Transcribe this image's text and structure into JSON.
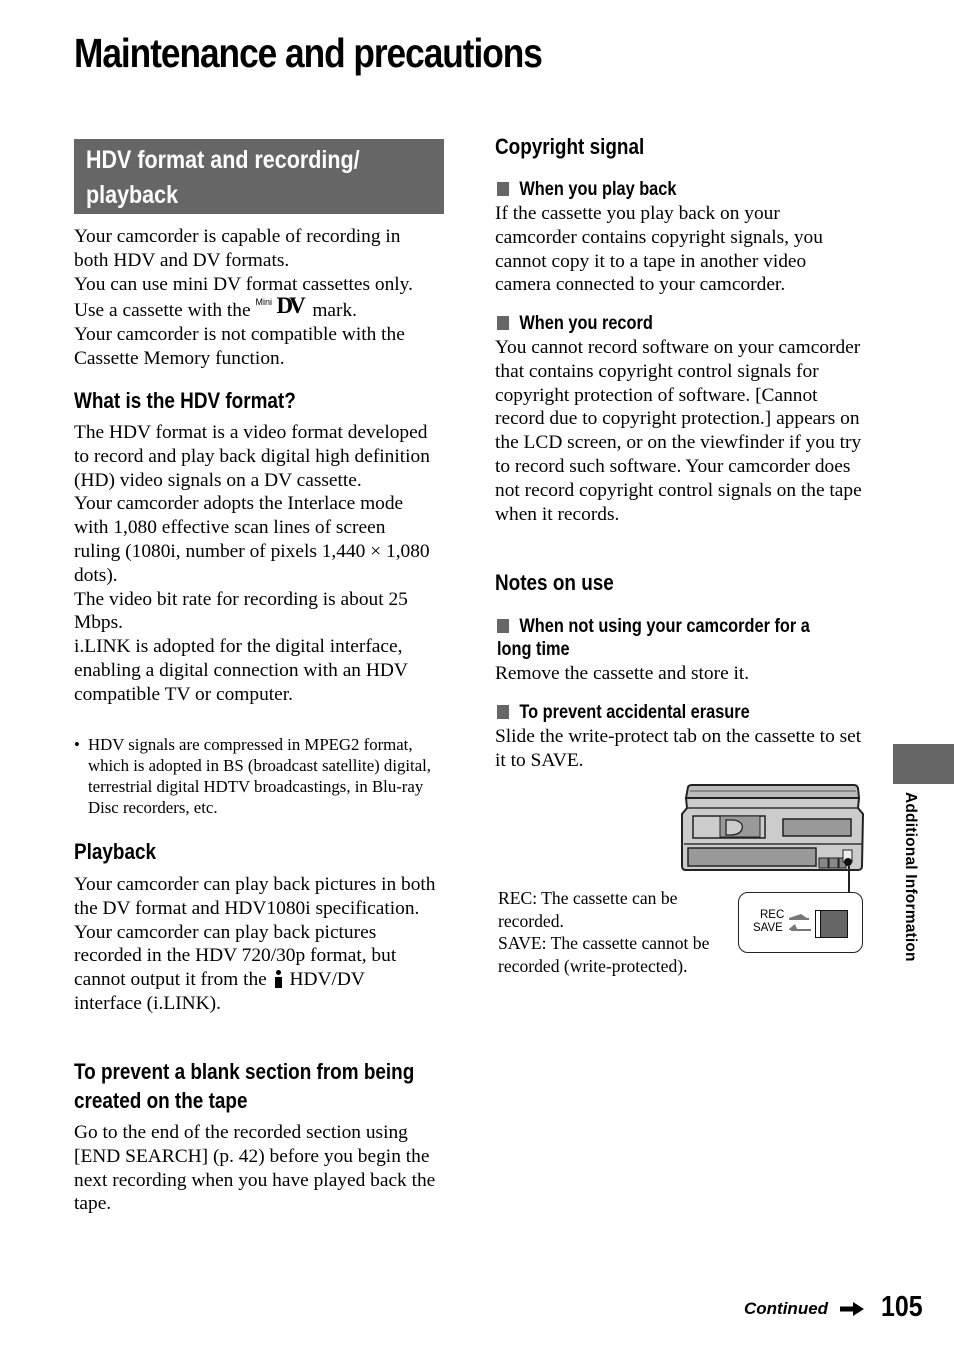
{
  "page": {
    "title": "Maintenance and precautions",
    "side_tab_label": "Additional Information",
    "footer": {
      "continued": "Continued",
      "page_number": "105"
    }
  },
  "left": {
    "banner": {
      "line1": "HDV format and recording/",
      "line2": "playback"
    },
    "intro": {
      "p1": "Your camcorder is capable of recording in both HDV and DV formats.",
      "p2": "You can use mini DV format cassettes only.",
      "p3_before": "Use a cassette with the",
      "p3_mark_small": "Mini",
      "p3_mark_big": "DV",
      "p3_after": "mark.",
      "p4": "Your camcorder is not compatible with the Cassette Memory function."
    },
    "hdv_format": {
      "heading": "What is the HDV format?",
      "p1": "The HDV format is a video format developed to record and play back digital high definition (HD) video signals on a DV cassette.",
      "p2": "Your camcorder adopts the Interlace mode with 1,080 effective scan lines of screen ruling (1080i, number of pixels 1,440 × 1,080 dots).",
      "p3": "The video bit rate for recording is about 25 Mbps.",
      "p4": "i.LINK is adopted for the digital interface, enabling a digital connection with an HDV compatible TV or computer.",
      "note_bullet": "•",
      "note": "HDV signals are compressed in MPEG2 format, which is adopted in BS (broadcast satellite) digital, terrestrial digital HDTV broadcastings, in Blu-ray Disc recorders, etc."
    },
    "playback": {
      "heading": "Playback",
      "p1": "Your camcorder can play back pictures in both the DV format and HDV1080i specification.",
      "p2_before": "Your camcorder can play back pictures recorded in the HDV 720/30p format, but cannot output it from the",
      "p2_icon": "i-link-icon",
      "p2_after": "HDV/DV interface (i.LINK)."
    },
    "blank_section": {
      "heading_line1": "To prevent a blank section from being",
      "heading_line2": "created on the tape",
      "p1": "Go to the end of the recorded section using [END SEARCH] (p. 42) before you begin the next recording when you have played back the tape."
    }
  },
  "right": {
    "copyright": {
      "heading": "Copyright signal",
      "playback_sub": "When you play back",
      "playback_text": "If the cassette you play back on your camcorder contains copyright signals, you cannot copy it to a tape in another video camera connected to your camcorder.",
      "record_sub": "When you record",
      "record_text": "You cannot record software on your camcorder that contains copyright control signals for copyright protection of software. [Cannot record due to copyright protection.] appears on the LCD screen, or on the viewfinder if you try to record such software. Your camcorder does not record copyright control signals on the tape when it records."
    },
    "notes": {
      "heading": "Notes on use",
      "long_time_sub_line1": "When not using your camcorder for a",
      "long_time_sub_line2": "long time",
      "long_time_text": "Remove the cassette and store it.",
      "erasure_sub": "To prevent accidental erasure",
      "erasure_text": "Slide the write-protect tab on the cassette to set it to SAVE."
    },
    "figure": {
      "rec_label": "REC",
      "save_label": "SAVE",
      "rec_desc": "REC: The cassette can be recorded.",
      "save_desc": "SAVE: The cassette cannot be recorded (write-protected)."
    }
  },
  "colors": {
    "banner_gray": "#666666",
    "text": "#000000",
    "background": "#ffffff"
  }
}
